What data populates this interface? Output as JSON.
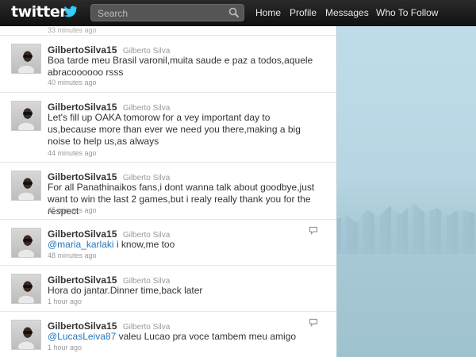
{
  "header": {
    "logo_text": "twitter",
    "search_placeholder": "Search",
    "nav": [
      "Home",
      "Profile",
      "Messages",
      "Who To Follow"
    ]
  },
  "colors": {
    "topbar": "#1a1a1a",
    "mention": "#2276bb",
    "background": "#c0deed"
  },
  "tweets": [
    {
      "screen_name": "",
      "full_name": "",
      "text": "",
      "time": "33 minutes ago"
    },
    {
      "screen_name": "GilbertoSilva15",
      "full_name": "Gilberto Silva",
      "text": "Boa tarde meu Brasil varonil,muita saude e paz a todos,aquele abracoooooo rsss",
      "time": "40 minutes ago"
    },
    {
      "screen_name": "GilbertoSilva15",
      "full_name": "Gilberto Silva",
      "text": "Let's fill up OAKA tomorow for a vey important day to us,because more than ever we need you there,making a big noise to help us,as always",
      "time": "44 minutes ago"
    },
    {
      "screen_name": "GilbertoSilva15",
      "full_name": "Gilberto Silva",
      "text": "For all Panathinaikos fans,i dont wanna talk about goodbye,just want to win the last 2 games,but i realy really thank you for the respect",
      "time": "45 minutes ago"
    },
    {
      "screen_name": "GilbertoSilva15",
      "full_name": "Gilberto Silva",
      "mention": "@maria_karlaki",
      "text": " i know,me too",
      "time": "48 minutes ago"
    },
    {
      "screen_name": "GilbertoSilva15",
      "full_name": "Gilberto Silva",
      "text": "Hora do jantar.Dinner time,back later",
      "time": "1 hour ago"
    },
    {
      "screen_name": "GilbertoSilva15",
      "full_name": "Gilberto Silva",
      "mention": "@LucasLeiva87",
      "text": " valeu Lucao pra voce tambem meu amigo",
      "time": "1 hour ago"
    }
  ]
}
